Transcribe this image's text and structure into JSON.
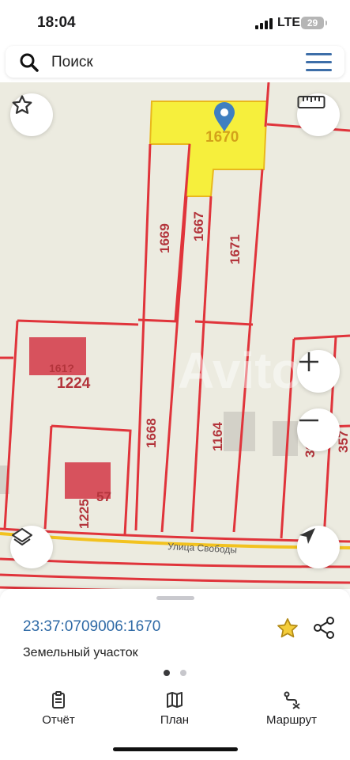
{
  "status_bar": {
    "time": "18:04",
    "network": "LTE",
    "battery": "29"
  },
  "search": {
    "placeholder": "Поиск"
  },
  "map": {
    "parcel_labels": [
      "1670",
      "1669",
      "1667",
      "1671",
      "1224",
      "1668",
      "1164",
      "1225",
      "57",
      "36",
      "357",
      "161?"
    ],
    "street_label": "Улица Свободы",
    "watermark": "Avito",
    "highlight_color": "#f6ef3c",
    "boundary_color": "#e0343b",
    "marker_color": "#3f7fc0"
  },
  "info_panel": {
    "cadastral_number": "23:37:0709006:1670",
    "object_type": "Земельный участок",
    "page_indicator": {
      "count": 2,
      "active": 1
    }
  },
  "tabs": [
    {
      "label": "Отчёт",
      "icon": "report-icon"
    },
    {
      "label": "План",
      "icon": "map-plan-icon"
    },
    {
      "label": "Маршрут",
      "icon": "route-icon"
    }
  ]
}
